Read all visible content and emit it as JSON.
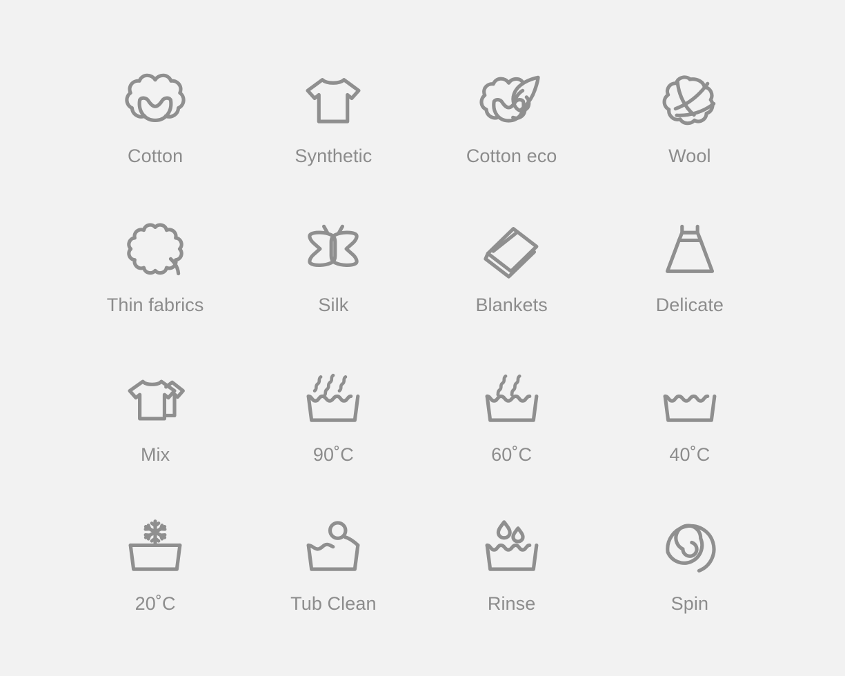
{
  "page": {
    "background_color": "#f2f2f2",
    "icon_stroke_color": "#8f8f8f",
    "label_color": "#8c8c8c",
    "grid": {
      "columns": 4,
      "rows": 4
    }
  },
  "icons": [
    {
      "id": "cotton",
      "icon": "cotton-boll-icon",
      "label": "Cotton"
    },
    {
      "id": "synthetic",
      "icon": "tshirt-icon",
      "label": "Synthetic"
    },
    {
      "id": "cotton-eco",
      "icon": "cotton-boll-leaf-icon",
      "label": "Cotton eco"
    },
    {
      "id": "wool",
      "icon": "yarn-ball-icon",
      "label": "Wool"
    },
    {
      "id": "thin-fabrics",
      "icon": "scalloped-flower-icon",
      "label": "Thin fabrics"
    },
    {
      "id": "silk",
      "icon": "butterfly-icon",
      "label": "Silk"
    },
    {
      "id": "blankets",
      "icon": "folded-blanket-icon",
      "label": "Blankets"
    },
    {
      "id": "delicate",
      "icon": "dress-icon",
      "label": "Delicate"
    },
    {
      "id": "mix",
      "icon": "two-tshirts-icon",
      "label": "Mix"
    },
    {
      "id": "wash-90",
      "icon": "wash-tub-three-steam-icon",
      "label": "90˚C"
    },
    {
      "id": "wash-60",
      "icon": "wash-tub-two-steam-icon",
      "label": "60˚C"
    },
    {
      "id": "wash-40",
      "icon": "wash-tub-icon",
      "label": "40˚C"
    },
    {
      "id": "wash-20",
      "icon": "wash-tub-snowflake-icon",
      "label": "20˚C"
    },
    {
      "id": "tub-clean",
      "icon": "wash-tub-bubble-icon",
      "label": "Tub Clean"
    },
    {
      "id": "rinse",
      "icon": "wash-tub-droplets-icon",
      "label": "Rinse"
    },
    {
      "id": "spin",
      "icon": "spiral-icon",
      "label": "Spin"
    }
  ]
}
